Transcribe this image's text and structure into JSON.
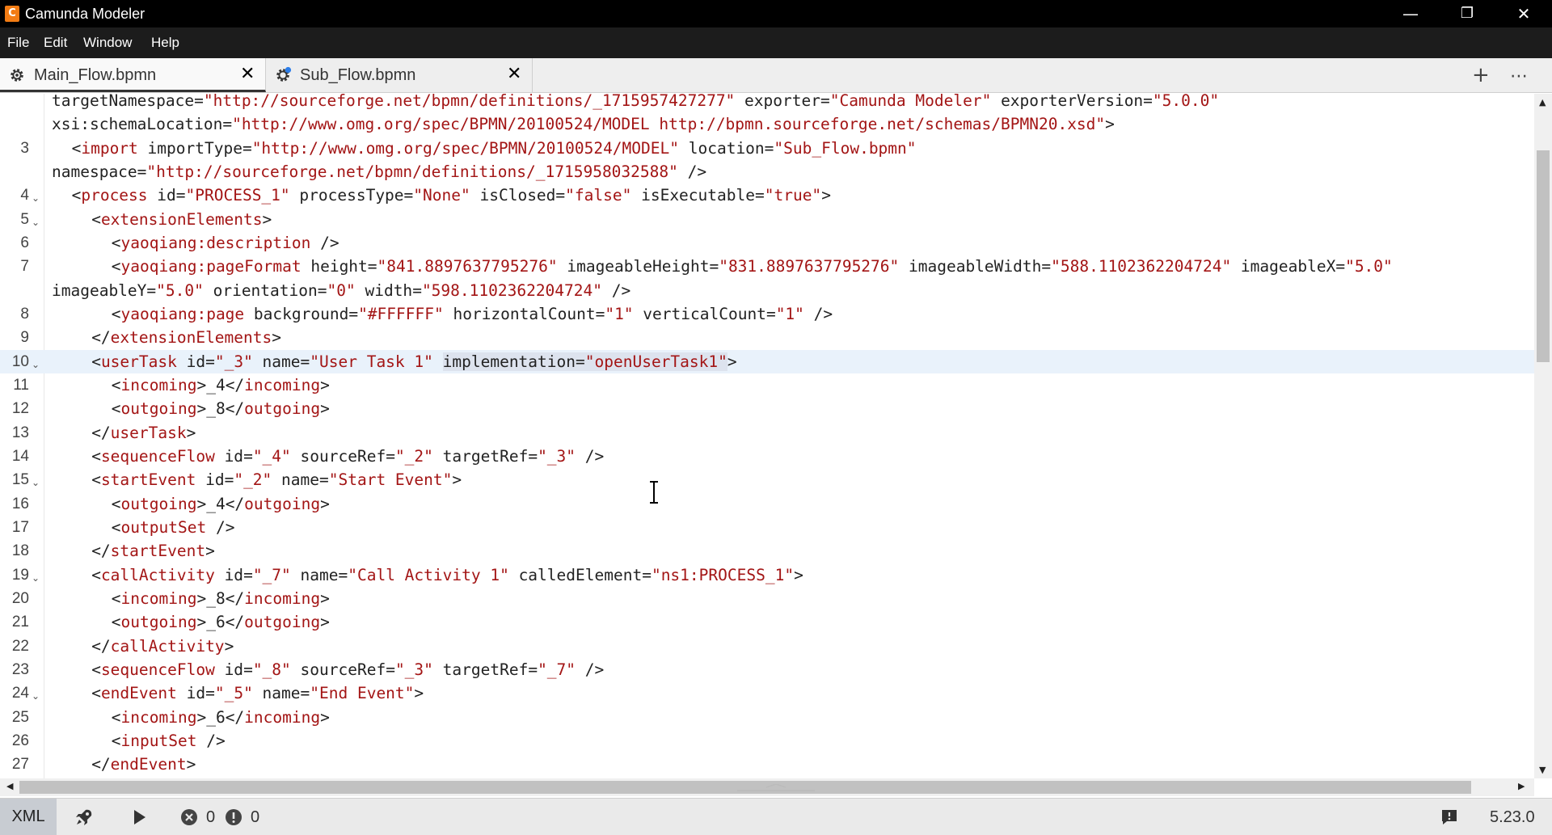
{
  "window": {
    "title": "Camunda Modeler",
    "controls": {
      "minimize": "—",
      "restore": "❐",
      "close": "✕"
    }
  },
  "menu": [
    "File",
    "Edit",
    "Window",
    "Help"
  ],
  "tabs": [
    {
      "label": "Main_Flow.bpmn",
      "icon": "gear-icon",
      "active": true
    },
    {
      "label": "Sub_Flow.bpmn",
      "icon": "gear-icon",
      "active": false
    }
  ],
  "tab_actions": {
    "add": "+",
    "more": "⋯"
  },
  "editor": {
    "lines": [
      {
        "n": "",
        "fold": false,
        "indent": 0,
        "tokens": [
          [
            "attr",
            "targetNamespace"
          ],
          [
            "punc",
            "="
          ],
          [
            "val",
            "\"http://sourceforge.net/bpmn/definitions/_1715957427277\""
          ],
          [
            "attr",
            " exporter"
          ],
          [
            "punc",
            "="
          ],
          [
            "val",
            "\"Camunda Modeler\""
          ],
          [
            "attr",
            " exporterVersion"
          ],
          [
            "punc",
            "="
          ],
          [
            "val",
            "\"5.0.0\""
          ]
        ]
      },
      {
        "n": "",
        "fold": false,
        "indent": 0,
        "tokens": [
          [
            "attr",
            "xsi:schemaLocation"
          ],
          [
            "punc",
            "="
          ],
          [
            "val",
            "\"http://www.omg.org/spec/BPMN/20100524/MODEL http://bpmn.sourceforge.net/schemas/BPMN20.xsd\""
          ],
          [
            "punc",
            ">"
          ]
        ]
      },
      {
        "n": "3",
        "fold": false,
        "indent": 1,
        "tokens": [
          [
            "punc",
            "<"
          ],
          [
            "tag",
            "import"
          ],
          [
            "attr",
            " importType"
          ],
          [
            "punc",
            "="
          ],
          [
            "val",
            "\"http://www.omg.org/spec/BPMN/20100524/MODEL\""
          ],
          [
            "attr",
            " location"
          ],
          [
            "punc",
            "="
          ],
          [
            "val",
            "\"Sub_Flow.bpmn\""
          ]
        ]
      },
      {
        "n": "",
        "fold": false,
        "indent": 0,
        "tokens": [
          [
            "attr",
            "namespace"
          ],
          [
            "punc",
            "="
          ],
          [
            "val",
            "\"http://sourceforge.net/bpmn/definitions/_1715958032588\""
          ],
          [
            "punc",
            " />"
          ]
        ]
      },
      {
        "n": "4",
        "fold": true,
        "indent": 1,
        "tokens": [
          [
            "punc",
            "<"
          ],
          [
            "tag",
            "process"
          ],
          [
            "attr",
            " id"
          ],
          [
            "punc",
            "="
          ],
          [
            "val",
            "\"PROCESS_1\""
          ],
          [
            "attr",
            " processType"
          ],
          [
            "punc",
            "="
          ],
          [
            "val",
            "\"None\""
          ],
          [
            "attr",
            " isClosed"
          ],
          [
            "punc",
            "="
          ],
          [
            "val",
            "\"false\""
          ],
          [
            "attr",
            " isExecutable"
          ],
          [
            "punc",
            "="
          ],
          [
            "val",
            "\"true\""
          ],
          [
            "punc",
            ">"
          ]
        ]
      },
      {
        "n": "5",
        "fold": true,
        "indent": 2,
        "tokens": [
          [
            "punc",
            "<"
          ],
          [
            "tag",
            "extensionElements"
          ],
          [
            "punc",
            ">"
          ]
        ]
      },
      {
        "n": "6",
        "fold": false,
        "indent": 3,
        "tokens": [
          [
            "punc",
            "<"
          ],
          [
            "tag",
            "yaoqiang:description"
          ],
          [
            "punc",
            " />"
          ]
        ]
      },
      {
        "n": "7",
        "fold": false,
        "indent": 3,
        "tokens": [
          [
            "punc",
            "<"
          ],
          [
            "tag",
            "yaoqiang:pageFormat"
          ],
          [
            "attr",
            " height"
          ],
          [
            "punc",
            "="
          ],
          [
            "val",
            "\"841.8897637795276\""
          ],
          [
            "attr",
            " imageableHeight"
          ],
          [
            "punc",
            "="
          ],
          [
            "val",
            "\"831.8897637795276\""
          ],
          [
            "attr",
            " imageableWidth"
          ],
          [
            "punc",
            "="
          ],
          [
            "val",
            "\"588.1102362204724\""
          ],
          [
            "attr",
            " imageableX"
          ],
          [
            "punc",
            "="
          ],
          [
            "val",
            "\"5.0\""
          ]
        ]
      },
      {
        "n": "",
        "fold": false,
        "indent": 0,
        "tokens": [
          [
            "attr",
            "imageableY"
          ],
          [
            "punc",
            "="
          ],
          [
            "val",
            "\"5.0\""
          ],
          [
            "attr",
            " orientation"
          ],
          [
            "punc",
            "="
          ],
          [
            "val",
            "\"0\""
          ],
          [
            "attr",
            " width"
          ],
          [
            "punc",
            "="
          ],
          [
            "val",
            "\"598.1102362204724\""
          ],
          [
            "punc",
            " />"
          ]
        ]
      },
      {
        "n": "8",
        "fold": false,
        "indent": 3,
        "tokens": [
          [
            "punc",
            "<"
          ],
          [
            "tag",
            "yaoqiang:page"
          ],
          [
            "attr",
            " background"
          ],
          [
            "punc",
            "="
          ],
          [
            "val",
            "\"#FFFFFF\""
          ],
          [
            "attr",
            " horizontalCount"
          ],
          [
            "punc",
            "="
          ],
          [
            "val",
            "\"1\""
          ],
          [
            "attr",
            " verticalCount"
          ],
          [
            "punc",
            "="
          ],
          [
            "val",
            "\"1\""
          ],
          [
            "punc",
            " />"
          ]
        ]
      },
      {
        "n": "9",
        "fold": false,
        "indent": 2,
        "tokens": [
          [
            "punc",
            "</"
          ],
          [
            "tag",
            "extensionElements"
          ],
          [
            "punc",
            ">"
          ]
        ]
      },
      {
        "n": "10",
        "fold": true,
        "indent": 2,
        "current": true,
        "tokens": [
          [
            "punc",
            "<"
          ],
          [
            "tag",
            "userTask"
          ],
          [
            "attr",
            " id"
          ],
          [
            "punc",
            "="
          ],
          [
            "val",
            "\"_3\""
          ],
          [
            "attr",
            " name"
          ],
          [
            "punc",
            "="
          ],
          [
            "val",
            "\"User Task 1\""
          ],
          [
            "attr",
            " "
          ],
          [
            "attrsel",
            "implementation"
          ],
          [
            "puncsel",
            "="
          ],
          [
            "valsel",
            "\"openUserTask1\""
          ],
          [
            "punc",
            ">"
          ]
        ]
      },
      {
        "n": "11",
        "fold": false,
        "indent": 3,
        "tokens": [
          [
            "punc",
            "<"
          ],
          [
            "tag",
            "incoming"
          ],
          [
            "punc",
            ">_4</"
          ],
          [
            "tag",
            "incoming"
          ],
          [
            "punc",
            ">"
          ]
        ]
      },
      {
        "n": "12",
        "fold": false,
        "indent": 3,
        "tokens": [
          [
            "punc",
            "<"
          ],
          [
            "tag",
            "outgoing"
          ],
          [
            "punc",
            ">_8</"
          ],
          [
            "tag",
            "outgoing"
          ],
          [
            "punc",
            ">"
          ]
        ]
      },
      {
        "n": "13",
        "fold": false,
        "indent": 2,
        "tokens": [
          [
            "punc",
            "</"
          ],
          [
            "tag",
            "userTask"
          ],
          [
            "punc",
            ">"
          ]
        ]
      },
      {
        "n": "14",
        "fold": false,
        "indent": 2,
        "tokens": [
          [
            "punc",
            "<"
          ],
          [
            "tag",
            "sequenceFlow"
          ],
          [
            "attr",
            " id"
          ],
          [
            "punc",
            "="
          ],
          [
            "val",
            "\"_4\""
          ],
          [
            "attr",
            " sourceRef"
          ],
          [
            "punc",
            "="
          ],
          [
            "val",
            "\"_2\""
          ],
          [
            "attr",
            " targetRef"
          ],
          [
            "punc",
            "="
          ],
          [
            "val",
            "\"_3\""
          ],
          [
            "punc",
            " />"
          ]
        ]
      },
      {
        "n": "15",
        "fold": true,
        "indent": 2,
        "tokens": [
          [
            "punc",
            "<"
          ],
          [
            "tag",
            "startEvent"
          ],
          [
            "attr",
            " id"
          ],
          [
            "punc",
            "="
          ],
          [
            "val",
            "\"_2\""
          ],
          [
            "attr",
            " name"
          ],
          [
            "punc",
            "="
          ],
          [
            "val",
            "\"Start Event\""
          ],
          [
            "punc",
            ">"
          ]
        ]
      },
      {
        "n": "16",
        "fold": false,
        "indent": 3,
        "tokens": [
          [
            "punc",
            "<"
          ],
          [
            "tag",
            "outgoing"
          ],
          [
            "punc",
            ">_4</"
          ],
          [
            "tag",
            "outgoing"
          ],
          [
            "punc",
            ">"
          ]
        ]
      },
      {
        "n": "17",
        "fold": false,
        "indent": 3,
        "tokens": [
          [
            "punc",
            "<"
          ],
          [
            "tag",
            "outputSet"
          ],
          [
            "punc",
            " />"
          ]
        ]
      },
      {
        "n": "18",
        "fold": false,
        "indent": 2,
        "tokens": [
          [
            "punc",
            "</"
          ],
          [
            "tag",
            "startEvent"
          ],
          [
            "punc",
            ">"
          ]
        ]
      },
      {
        "n": "19",
        "fold": true,
        "indent": 2,
        "tokens": [
          [
            "punc",
            "<"
          ],
          [
            "tag",
            "callActivity"
          ],
          [
            "attr",
            " id"
          ],
          [
            "punc",
            "="
          ],
          [
            "val",
            "\"_7\""
          ],
          [
            "attr",
            " name"
          ],
          [
            "punc",
            "="
          ],
          [
            "val",
            "\"Call Activity 1\""
          ],
          [
            "attr",
            " calledElement"
          ],
          [
            "punc",
            "="
          ],
          [
            "val",
            "\"ns1:PROCESS_1\""
          ],
          [
            "punc",
            ">"
          ]
        ]
      },
      {
        "n": "20",
        "fold": false,
        "indent": 3,
        "tokens": [
          [
            "punc",
            "<"
          ],
          [
            "tag",
            "incoming"
          ],
          [
            "punc",
            ">_8</"
          ],
          [
            "tag",
            "incoming"
          ],
          [
            "punc",
            ">"
          ]
        ]
      },
      {
        "n": "21",
        "fold": false,
        "indent": 3,
        "tokens": [
          [
            "punc",
            "<"
          ],
          [
            "tag",
            "outgoing"
          ],
          [
            "punc",
            ">_6</"
          ],
          [
            "tag",
            "outgoing"
          ],
          [
            "punc",
            ">"
          ]
        ]
      },
      {
        "n": "22",
        "fold": false,
        "indent": 2,
        "tokens": [
          [
            "punc",
            "</"
          ],
          [
            "tag",
            "callActivity"
          ],
          [
            "punc",
            ">"
          ]
        ]
      },
      {
        "n": "23",
        "fold": false,
        "indent": 2,
        "tokens": [
          [
            "punc",
            "<"
          ],
          [
            "tag",
            "sequenceFlow"
          ],
          [
            "attr",
            " id"
          ],
          [
            "punc",
            "="
          ],
          [
            "val",
            "\"_8\""
          ],
          [
            "attr",
            " sourceRef"
          ],
          [
            "punc",
            "="
          ],
          [
            "val",
            "\"_3\""
          ],
          [
            "attr",
            " targetRef"
          ],
          [
            "punc",
            "="
          ],
          [
            "val",
            "\"_7\""
          ],
          [
            "punc",
            " />"
          ]
        ]
      },
      {
        "n": "24",
        "fold": true,
        "indent": 2,
        "tokens": [
          [
            "punc",
            "<"
          ],
          [
            "tag",
            "endEvent"
          ],
          [
            "attr",
            " id"
          ],
          [
            "punc",
            "="
          ],
          [
            "val",
            "\"_5\""
          ],
          [
            "attr",
            " name"
          ],
          [
            "punc",
            "="
          ],
          [
            "val",
            "\"End Event\""
          ],
          [
            "punc",
            ">"
          ]
        ]
      },
      {
        "n": "25",
        "fold": false,
        "indent": 3,
        "tokens": [
          [
            "punc",
            "<"
          ],
          [
            "tag",
            "incoming"
          ],
          [
            "punc",
            ">_6</"
          ],
          [
            "tag",
            "incoming"
          ],
          [
            "punc",
            ">"
          ]
        ]
      },
      {
        "n": "26",
        "fold": false,
        "indent": 3,
        "tokens": [
          [
            "punc",
            "<"
          ],
          [
            "tag",
            "inputSet"
          ],
          [
            "punc",
            " />"
          ]
        ]
      },
      {
        "n": "27",
        "fold": false,
        "indent": 2,
        "tokens": [
          [
            "punc",
            "</"
          ],
          [
            "tag",
            "endEvent"
          ],
          [
            "punc",
            ">"
          ]
        ]
      }
    ]
  },
  "statusbar": {
    "view_label": "XML",
    "deploy_icon": "rocket-icon",
    "run_icon": "play-icon",
    "errors": "0",
    "warnings": "0",
    "feedback_icon": "feedback-icon",
    "version": "5.23.0"
  },
  "colors": {
    "tag": "#a31515",
    "value": "#a31515",
    "text": "#222222",
    "current_line": "#e9f2fb",
    "selection": "#dde3ee",
    "titlebar": "#000000",
    "menubar": "#1c1c1c",
    "accent": "#f27c14"
  }
}
